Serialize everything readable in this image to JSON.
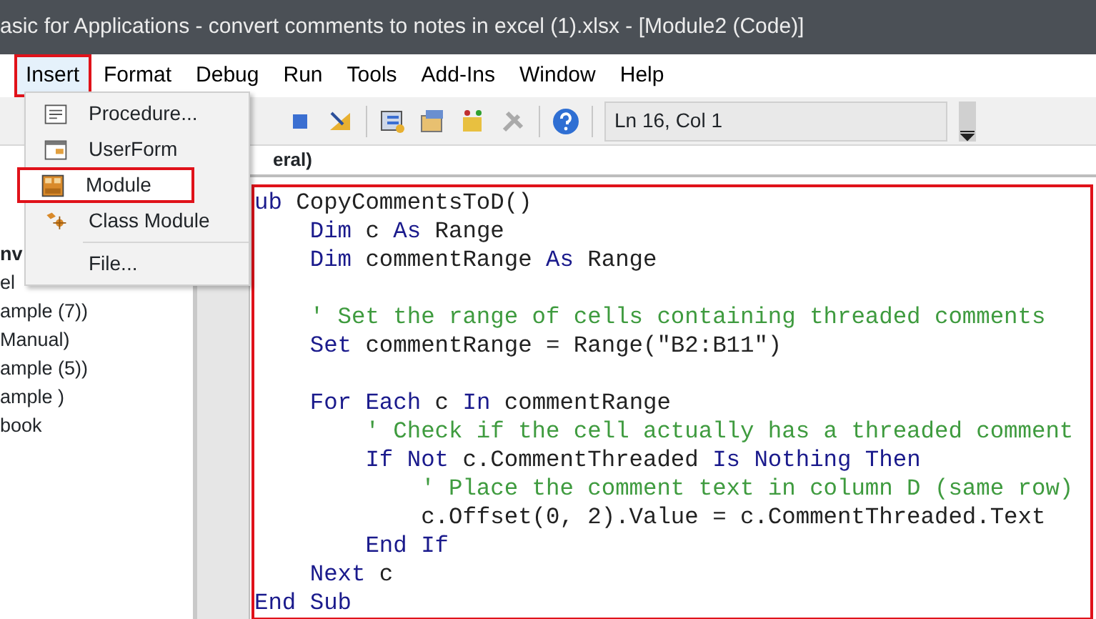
{
  "window": {
    "title": "asic for Applications - convert comments to notes in excel (1).xlsx - [Module2 (Code)]"
  },
  "menu_bar": [
    {
      "label": "Insert",
      "selected": true,
      "annotated": true
    },
    {
      "label": "Format",
      "selected": false,
      "annotated": false
    },
    {
      "label": "Debug",
      "selected": false,
      "annotated": false
    },
    {
      "label": "Run",
      "selected": false,
      "annotated": false
    },
    {
      "label": "Tools",
      "selected": false,
      "annotated": false
    },
    {
      "label": "Add-Ins",
      "selected": false,
      "annotated": false
    },
    {
      "label": "Window",
      "selected": false,
      "annotated": false
    },
    {
      "label": "Help",
      "selected": false,
      "annotated": false
    }
  ],
  "insert_menu": [
    {
      "kind": "item",
      "label": "Procedure...",
      "selected": false,
      "annotated": false
    },
    {
      "kind": "item",
      "label": "UserForm",
      "selected": false,
      "annotated": false
    },
    {
      "kind": "item",
      "label": "Module",
      "selected": true,
      "annotated": true
    },
    {
      "kind": "item",
      "label": "Class Module",
      "selected": false,
      "annotated": false
    },
    {
      "kind": "separator"
    },
    {
      "kind": "item",
      "label": "File...",
      "selected": false,
      "annotated": false
    }
  ],
  "toolbar": {
    "position": "Ln 16, Col 1"
  },
  "project_tree": [
    {
      "label": "nv",
      "bold": true
    },
    {
      "label": "el",
      "bold": false
    },
    {
      "label": "ample (7))",
      "bold": false
    },
    {
      "label": "Manual)",
      "bold": false
    },
    {
      "label": "ample (5))",
      "bold": false
    },
    {
      "label": "ample )",
      "bold": false
    },
    {
      "label": "book",
      "bold": false
    }
  ],
  "code_window": {
    "object_box": "eral)",
    "annotated": true,
    "lines": [
      {
        "kind": "code",
        "tokens": [
          {
            "kind": "keyword",
            "text": "ub"
          },
          {
            "kind": "plain",
            "text": " CopyCommentsToD()"
          }
        ]
      },
      {
        "kind": "code",
        "tokens": [
          {
            "kind": "keyword",
            "text": "    Dim"
          },
          {
            "kind": "plain",
            "text": " c "
          },
          {
            "kind": "keyword",
            "text": "As"
          },
          {
            "kind": "plain",
            "text": " Range"
          }
        ]
      },
      {
        "kind": "code",
        "tokens": [
          {
            "kind": "keyword",
            "text": "    Dim"
          },
          {
            "kind": "plain",
            "text": " commentRange "
          },
          {
            "kind": "keyword",
            "text": "As"
          },
          {
            "kind": "plain",
            "text": " Range"
          }
        ]
      },
      {
        "kind": "blank"
      },
      {
        "kind": "code",
        "tokens": [
          {
            "kind": "comment",
            "text": "    ' Set the range of cells containing threaded comments"
          }
        ]
      },
      {
        "kind": "code",
        "tokens": [
          {
            "kind": "keyword",
            "text": "    Set"
          },
          {
            "kind": "plain",
            "text": " commentRange = Range(\"B2:B11\")"
          }
        ]
      },
      {
        "kind": "blank"
      },
      {
        "kind": "code",
        "tokens": [
          {
            "kind": "keyword",
            "text": "    For Each"
          },
          {
            "kind": "plain",
            "text": " c "
          },
          {
            "kind": "keyword",
            "text": "In"
          },
          {
            "kind": "plain",
            "text": " commentRange"
          }
        ]
      },
      {
        "kind": "code",
        "tokens": [
          {
            "kind": "comment",
            "text": "        ' Check if the cell actually has a threaded comment"
          }
        ]
      },
      {
        "kind": "code",
        "tokens": [
          {
            "kind": "keyword",
            "text": "        If Not"
          },
          {
            "kind": "plain",
            "text": " c.CommentThreaded "
          },
          {
            "kind": "keyword",
            "text": "Is Nothing Then"
          }
        ]
      },
      {
        "kind": "code",
        "tokens": [
          {
            "kind": "comment",
            "text": "            ' Place the comment text in column D (same row)"
          }
        ]
      },
      {
        "kind": "code",
        "tokens": [
          {
            "kind": "plain",
            "text": "            c.Offset(0, 2).Value = c.CommentThreaded.Text"
          }
        ]
      },
      {
        "kind": "code",
        "tokens": [
          {
            "kind": "keyword",
            "text": "        End If"
          }
        ]
      },
      {
        "kind": "code",
        "tokens": [
          {
            "kind": "keyword",
            "text": "    Next"
          },
          {
            "kind": "plain",
            "text": " c"
          }
        ]
      },
      {
        "kind": "code",
        "tokens": [
          {
            "kind": "keyword",
            "text": "End Sub"
          }
        ]
      }
    ]
  }
}
